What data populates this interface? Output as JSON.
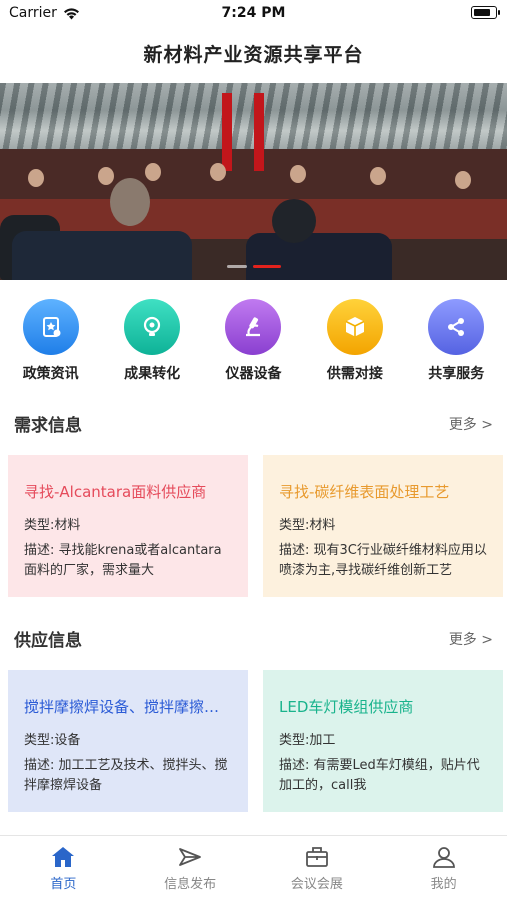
{
  "status_bar": {
    "carrier": "Carrier",
    "time": "7:24 PM",
    "battery_level": 0.85
  },
  "header": {
    "title": "新材料产业资源共享平台"
  },
  "banner": {
    "slide_count": 2,
    "active_slide": 2
  },
  "categories": [
    {
      "label": "政策资讯",
      "icon": "policy-document-icon",
      "color": "#2b8cf0"
    },
    {
      "label": "成果转化",
      "icon": "lightbulb-icon",
      "color": "#16c0a6"
    },
    {
      "label": "仪器设备",
      "icon": "microscope-icon",
      "color": "#9b52d9"
    },
    {
      "label": "供需对接",
      "icon": "box-icon",
      "color": "#f5b400"
    },
    {
      "label": "共享服务",
      "icon": "share-icon",
      "color": "#6a78ee"
    }
  ],
  "demand": {
    "title": "需求信息",
    "more": "更多 >",
    "cards": [
      {
        "title": "寻找-Alcantara面料供应商",
        "type": "类型:材料",
        "desc": "描述: 寻找能krena或者alcantara面料的厂家，需求量大",
        "bg": "#fde6e8",
        "color": "#e54b5b"
      },
      {
        "title": "寻找-碳纤维表面处理工艺",
        "type": "类型:材料",
        "desc": "描述: 现有3C行业碳纤维材料应用以喷漆为主,寻找碳纤维创新工艺",
        "bg": "#fdf1de",
        "color": "#e89a2e"
      }
    ]
  },
  "supply": {
    "title": "供应信息",
    "more": "更多 >",
    "cards": [
      {
        "title": "搅拌摩擦焊设备、搅拌摩擦焊技术",
        "type": "类型:设备",
        "desc": "描述: 加工工艺及技术、搅拌头、搅拌摩擦焊设备",
        "bg": "#dfe6f8",
        "color": "#2b5bd6"
      },
      {
        "title": "LED车灯模组供应商",
        "type": "类型:加工",
        "desc": "描述: 有需要Led车灯模组，贴片代加工的，call我",
        "bg": "#dcf3ec",
        "color": "#19b38c"
      }
    ]
  },
  "tabbar": [
    {
      "label": "首页",
      "icon": "home-icon",
      "active": true
    },
    {
      "label": "信息发布",
      "icon": "paper-plane-icon",
      "active": false
    },
    {
      "label": "会议会展",
      "icon": "briefcase-icon",
      "active": false
    },
    {
      "label": "我的",
      "icon": "user-icon",
      "active": false
    }
  ],
  "accent": "#2a66c9"
}
